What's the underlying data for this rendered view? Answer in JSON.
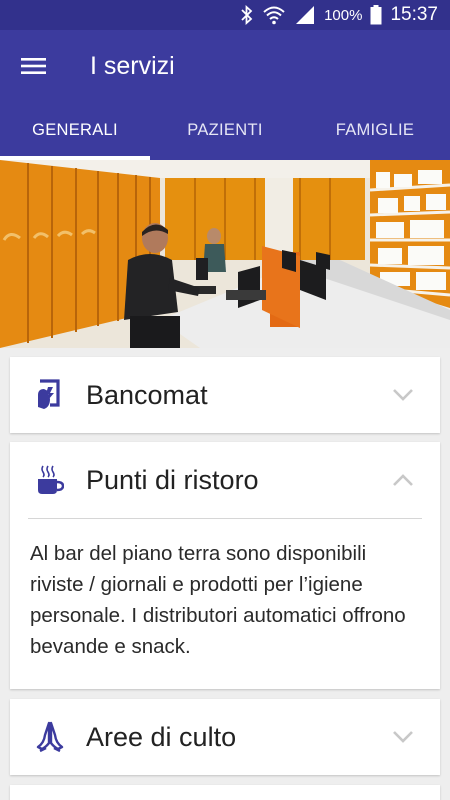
{
  "status_bar": {
    "battery_percent": "100%",
    "time": "15:37",
    "icons": [
      "bluetooth-icon",
      "wifi-icon",
      "signal-icon",
      "battery-icon"
    ]
  },
  "app_bar": {
    "title": "I servizi",
    "menu_icon": "hamburger-menu-icon"
  },
  "tabs": [
    {
      "label": "GENERALI",
      "active": true
    },
    {
      "label": "PAZIENTI",
      "active": false
    },
    {
      "label": "FAMIGLIE",
      "active": false
    }
  ],
  "colors": {
    "primary": "#3c3b9e",
    "status_bar": "#32318c",
    "icon": "#3c3b9e",
    "background": "#eeeeee"
  },
  "services": [
    {
      "title": "Bancomat",
      "icon": "atm-card-icon",
      "expanded": false,
      "body": ""
    },
    {
      "title": "Punti di ristoro",
      "icon": "coffee-cup-icon",
      "expanded": true,
      "body": "Al bar del piano terra sono disponibili riviste / giornali e prodotti per l’igiene personale. I distributori automatici offrono bevande e snack."
    },
    {
      "title": "Aree di culto",
      "icon": "praying-hands-icon",
      "expanded": false,
      "body": ""
    }
  ]
}
